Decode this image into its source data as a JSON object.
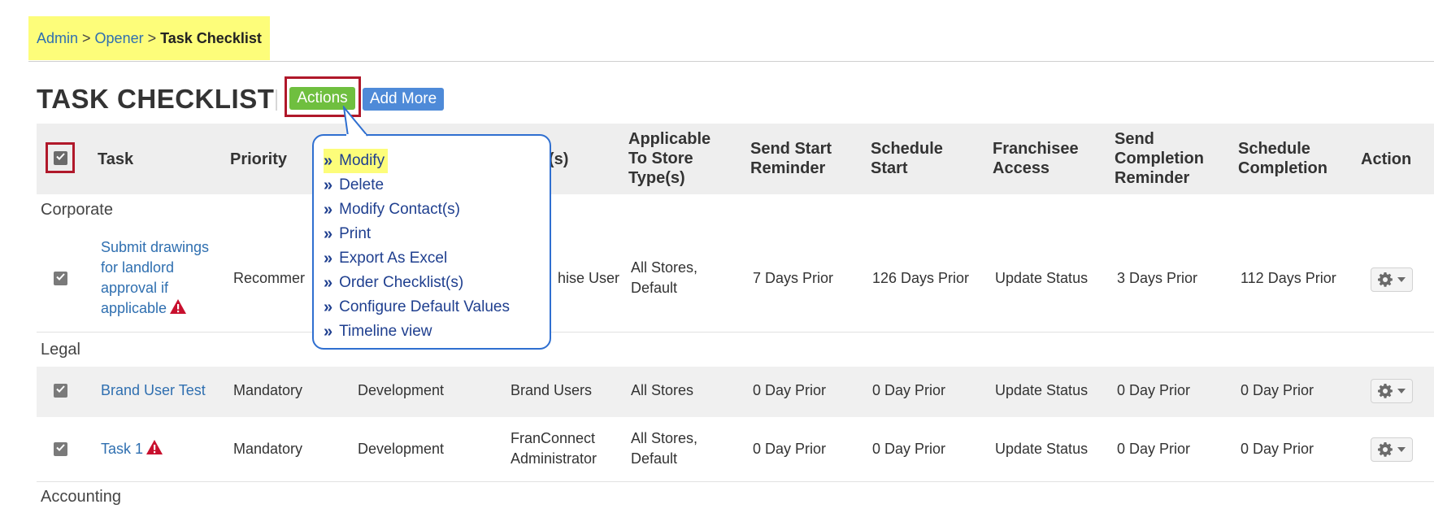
{
  "breadcrumb": {
    "admin": "Admin",
    "sep": ">",
    "opener": "Opener",
    "current": "Task Checklist"
  },
  "page": {
    "title": "TASK CHECKLIST"
  },
  "toolbar": {
    "actions_label": "Actions",
    "add_more_label": "Add More"
  },
  "columns": {
    "task": "Task",
    "priority": "Priority",
    "contacts": "act(s)",
    "store_types": [
      "Applicable",
      "To Store",
      "Type(s)"
    ],
    "send_start": [
      "Send Start",
      "Reminder"
    ],
    "schedule_start": [
      "Schedule",
      "Start"
    ],
    "franchisee_access": [
      "Franchisee",
      "Access"
    ],
    "send_completion": [
      "Send",
      "Completion",
      "Reminder"
    ],
    "schedule_completion": [
      "Schedule",
      "Completion"
    ],
    "action": "Action"
  },
  "groups": {
    "corporate": "Corporate",
    "legal": "Legal",
    "accounting": "Accounting"
  },
  "rows": [
    {
      "task": [
        "Submit drawings",
        "for landlord",
        "approval if",
        "applicable"
      ],
      "priority": "Recommer",
      "contacts": "hise User",
      "store_types": [
        "All Stores,",
        "Default"
      ],
      "send_start": "7 Days Prior",
      "schedule_start": "126 Days Prior",
      "franchisee_access": "Update Status",
      "send_completion": "3 Days Prior",
      "schedule_completion": "112 Days Prior"
    },
    {
      "task": "Brand User Test",
      "priority": "Mandatory",
      "department": "Development",
      "contacts": "Brand Users",
      "store_types": "All Stores",
      "send_start": "0 Day Prior",
      "schedule_start": "0 Day Prior",
      "franchisee_access": "Update Status",
      "send_completion": "0 Day Prior",
      "schedule_completion": "0 Day Prior"
    },
    {
      "task": "Task 1",
      "priority": "Mandatory",
      "department": "Development",
      "contacts": [
        "FranConnect",
        "Administrator"
      ],
      "store_types": [
        "All Stores,",
        "Default"
      ],
      "send_start": "0 Day Prior",
      "schedule_start": "0 Day Prior",
      "franchisee_access": "Update Status",
      "send_completion": "0 Day Prior",
      "schedule_completion": "0 Day Prior"
    }
  ],
  "actions_menu": {
    "chevron": "»",
    "items": [
      "Modify",
      "Delete",
      "Modify Contact(s)",
      "Print",
      "Export As Excel",
      "Order Checklist(s)",
      "Configure Default Values",
      "Timeline view"
    ]
  },
  "colors": {
    "highlight": "#fdfd7a",
    "link": "#2f6fb0",
    "actions_button": "#6fbf3f",
    "add_more_button": "#4e8ad8",
    "annotation_frame": "#b0182a",
    "popup_border": "#2f6fd0",
    "warning": "#c8102e"
  },
  "icons": {
    "warning": "warning-triangle-icon",
    "gear": "gear-icon",
    "caret": "caret-down-icon",
    "check": "checkmark-icon"
  }
}
